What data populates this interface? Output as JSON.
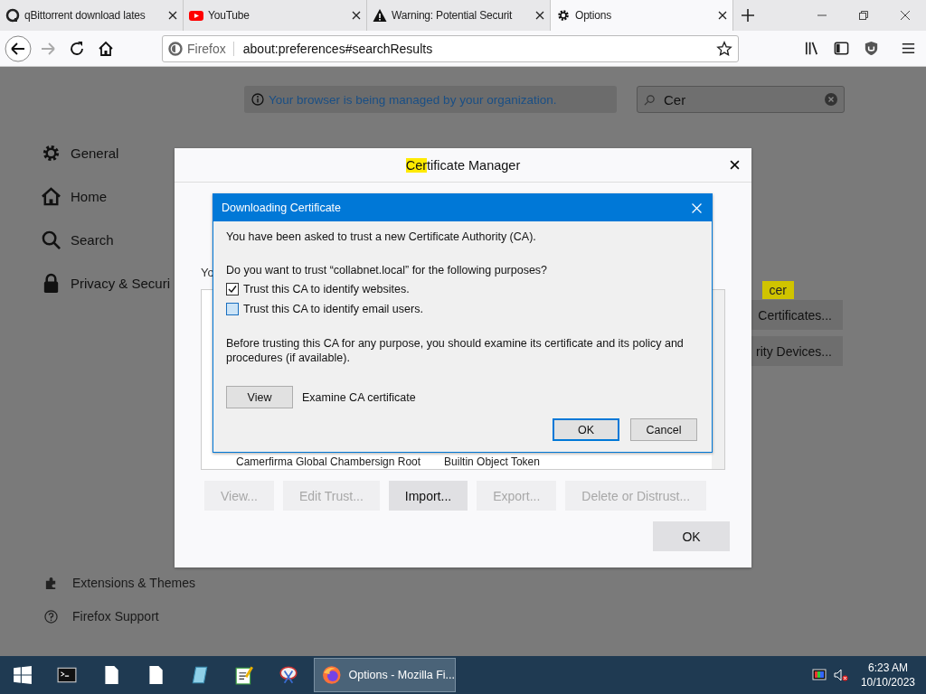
{
  "browser": {
    "tabs": [
      {
        "title": "qBittorrent download lates",
        "selected": false
      },
      {
        "title": "YouTube",
        "selected": false
      },
      {
        "title": "Warning: Potential Securit",
        "selected": false
      },
      {
        "title": "Options",
        "selected": true
      }
    ],
    "identity": "Firefox",
    "url": "about:preferences#searchResults"
  },
  "page": {
    "banner": "Your browser is being managed by your organization.",
    "search_value": "Cer",
    "sidebar": [
      "General",
      "Home",
      "Search",
      "Privacy & Securi"
    ],
    "sidebar_bottom": [
      "Extensions & Themes",
      "Firefox Support"
    ],
    "partial_text": "Yo",
    "match_badge": "cer",
    "buttons": [
      "Certificates...",
      "rity Devices..."
    ]
  },
  "cert_manager": {
    "title_match": "Cer",
    "title_rest": "tificate Manager",
    "row": [
      "Camerfirma Global Chambersign Root",
      "Builtin Object Token"
    ],
    "buttons": [
      {
        "label": "View...",
        "disabled": true
      },
      {
        "label": "Edit Trust...",
        "disabled": true
      },
      {
        "label": "Import...",
        "disabled": false
      },
      {
        "label": "Export...",
        "disabled": true
      },
      {
        "label": "Delete or Distrust...",
        "disabled": true
      }
    ],
    "ok": "OK"
  },
  "download_dialog": {
    "title": "Downloading Certificate",
    "intro": "You have been asked to trust a new Certificate Authority (CA).",
    "question": "Do you want to trust “collabnet.local” for the following purposes?",
    "checks": [
      {
        "label": "Trust this CA to identify websites.",
        "checked": true
      },
      {
        "label": "Trust this CA to identify email users.",
        "checked": false
      }
    ],
    "note": "Before trusting this CA for any purpose, you should examine its certificate and its policy and procedures (if available).",
    "view_button": "View",
    "view_label": "Examine CA certificate",
    "ok": "OK",
    "cancel": "Cancel"
  },
  "taskbar": {
    "active_app": "Options - Mozilla Fi...",
    "time": "6:23 AM",
    "date": "10/10/2023"
  }
}
